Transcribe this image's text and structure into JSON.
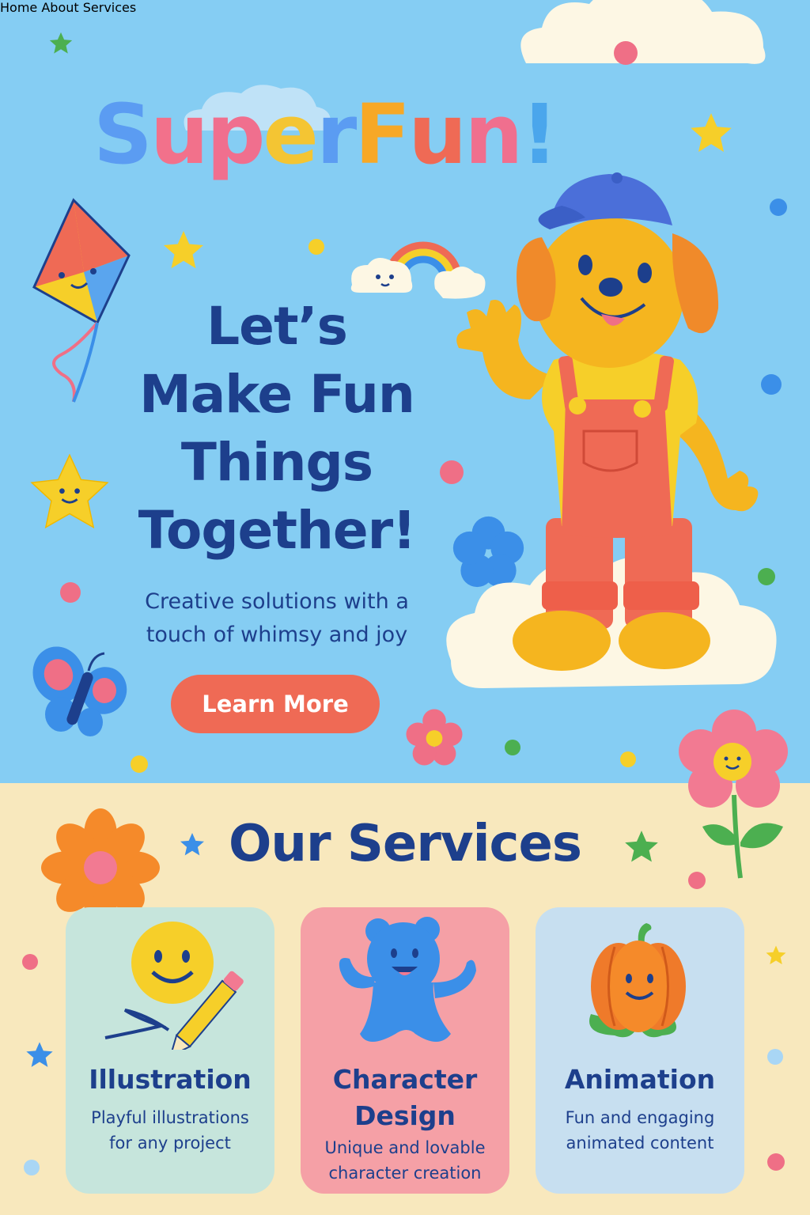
{
  "nav": {
    "items": [
      {
        "label": "Home"
      },
      {
        "label": "About"
      },
      {
        "label": "Services"
      }
    ]
  },
  "hero": {
    "brand_letters": [
      {
        "char": "S",
        "color": "#5b9cf2"
      },
      {
        "char": "u",
        "color": "#f2718b"
      },
      {
        "char": "p",
        "color": "#f06f8e"
      },
      {
        "char": "e",
        "color": "#f4c533"
      },
      {
        "char": "r",
        "color": "#5b9cf2"
      },
      {
        "char": "F",
        "color": "#f7a826"
      },
      {
        "char": "u",
        "color": "#ef6a55"
      },
      {
        "char": "n",
        "color": "#f06f8e"
      },
      {
        "char": "!",
        "color": "#4aa6ec"
      }
    ],
    "headline_lines": [
      "Let’s",
      "Make Fun",
      "Things",
      "Together!"
    ],
    "subtitle_lines": [
      "Creative solutions with a",
      "touch of whimsy and joy"
    ],
    "cta_label": "Learn More"
  },
  "services": {
    "title": "Our Services",
    "cards": [
      {
        "title_lines": [
          "Illustration"
        ],
        "desc_lines": [
          "Playful illustrations",
          "for any project"
        ],
        "bg": "#c6e5dc",
        "icon": "smiley-pencil-icon"
      },
      {
        "title_lines": [
          "Character",
          "Design"
        ],
        "desc_lines": [
          "Unique and lovable",
          "character creation"
        ],
        "bg": "#f5a0a6",
        "icon": "blue-bear-icon"
      },
      {
        "title_lines": [
          "Animation"
        ],
        "desc_lines": [
          "Fun and engaging",
          "animated content"
        ],
        "bg": "#c7dff0",
        "icon": "pumpkin-icon"
      }
    ]
  },
  "colors": {
    "sky": "#85cdf3",
    "cream": "#f8e8bd",
    "navy": "#1d3f8c",
    "coral": "#ef6a55"
  }
}
